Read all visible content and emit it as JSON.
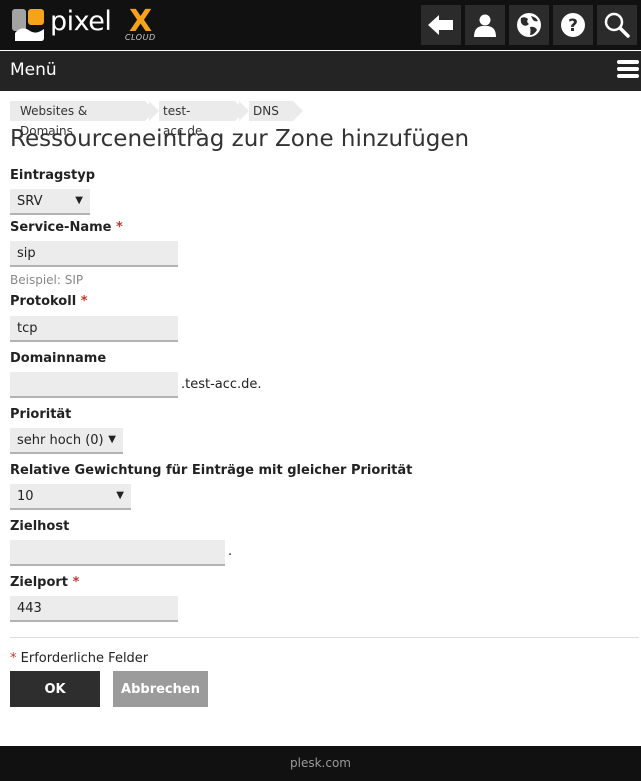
{
  "header": {
    "brand": {
      "name": "pixel",
      "accent": "X",
      "sub": "CLOUD",
      "accent_color": "#f7a21b"
    },
    "icons": [
      {
        "name": "back-arrow-icon"
      },
      {
        "name": "user-icon"
      },
      {
        "name": "globe-icon"
      },
      {
        "name": "help-icon"
      },
      {
        "name": "search-icon"
      }
    ]
  },
  "menubar": {
    "label": "Menü",
    "icon": "hamburger-menu-icon"
  },
  "breadcrumb": [
    {
      "label": "Websites & Domains"
    },
    {
      "label": "test-acc.de"
    },
    {
      "label": "DNS"
    }
  ],
  "page": {
    "title": "Ressourceneintrag zur Zone hinzufügen"
  },
  "form": {
    "record_type": {
      "label": "Eintragstyp",
      "value": "SRV"
    },
    "service_name": {
      "label": "Service-Name",
      "required": "*",
      "value": "sip",
      "hint": "Beispiel: SIP"
    },
    "protocol": {
      "label": "Protokoll",
      "required": "*",
      "value": "tcp"
    },
    "domain_name": {
      "label": "Domainname",
      "value": "",
      "suffix": ".test-acc.de."
    },
    "priority": {
      "label": "Priorität",
      "value": "sehr hoch (0)"
    },
    "weight": {
      "label": "Relative Gewichtung für Einträge mit gleicher Priorität",
      "value": "10"
    },
    "target_host": {
      "label": "Zielhost",
      "value": "",
      "suffix": "."
    },
    "target_port": {
      "label": "Zielport",
      "required": "*",
      "value": "443"
    },
    "required_note_star": "*",
    "required_note": " Erforderliche Felder",
    "ok_label": "OK",
    "cancel_label": "Abbrechen"
  },
  "footer": {
    "link": "plesk.com"
  }
}
